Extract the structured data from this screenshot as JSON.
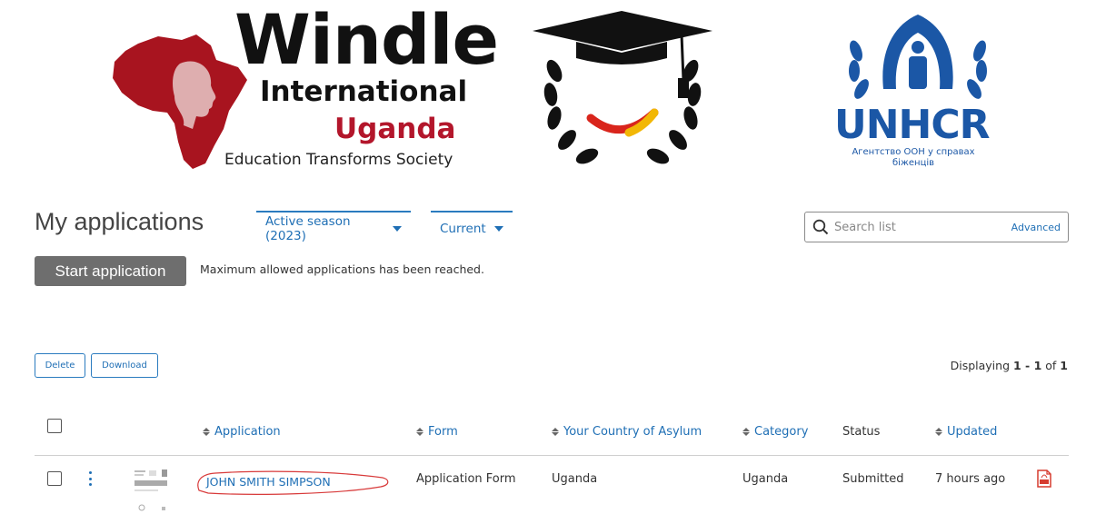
{
  "logos": {
    "windle": {
      "word": "Windle",
      "line2": "International",
      "line3": "Uganda",
      "tagline": "Education Transforms Society"
    },
    "unhcr": {
      "word": "UNHCR",
      "sub": "Агентство ООН у справах біженців"
    }
  },
  "header": {
    "title": "My applications",
    "season_filter": "Active season (2023)",
    "current_filter": "Current",
    "search_placeholder": "Search list",
    "advanced_label": "Advanced"
  },
  "actions": {
    "start_label": "Start application",
    "max_message": "Maximum allowed applications has been reached.",
    "delete_label": "Delete",
    "download_label": "Download"
  },
  "pagination": {
    "prefix": "Displaying ",
    "range": "1 - 1",
    "of": " of ",
    "total": "1"
  },
  "table": {
    "columns": {
      "application": "Application",
      "form": "Form",
      "country": "Your Country of Asylum",
      "category": "Category",
      "status": "Status",
      "updated": "Updated"
    },
    "rows": [
      {
        "application": "JOHN SMITH SIMPSON",
        "form": "Application Form",
        "country": "Uganda",
        "category": "Uganda",
        "status": "Submitted",
        "updated": "7 hours ago"
      }
    ]
  },
  "colors": {
    "accent": "#1f6fb5",
    "brand_red": "#b3162b",
    "unhcr_blue": "#1b57a6",
    "button_gray": "#6e6e6e"
  },
  "icons": [
    "search-icon",
    "caret-down-icon",
    "sort-icon",
    "kebab-menu-icon",
    "pdf-icon",
    "graduation-cap-icon",
    "unhcr-emblem-icon",
    "africa-map-icon"
  ]
}
